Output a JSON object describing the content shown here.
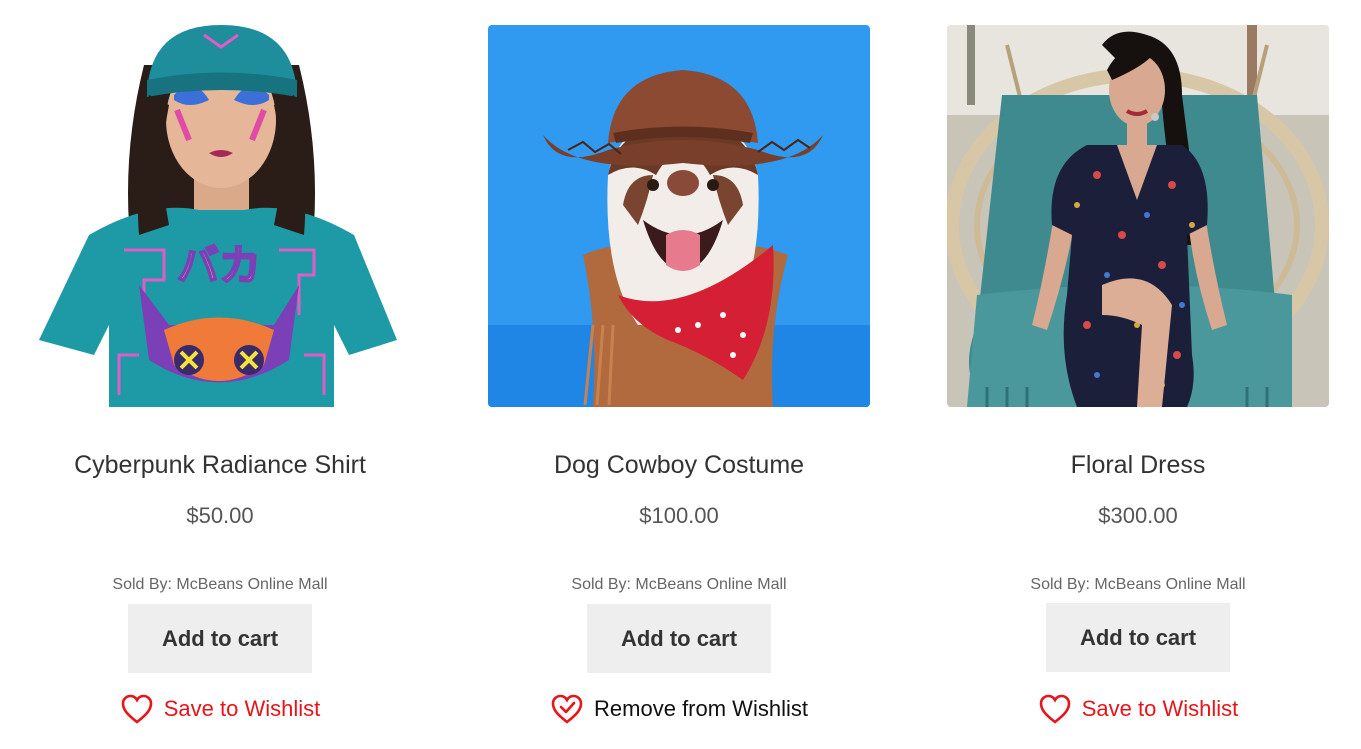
{
  "products": [
    {
      "title": "Cyberpunk Radiance Shirt",
      "price": "$50.00",
      "sold_by": "Sold By: McBeans Online Mall",
      "cart_label": "Add to cart",
      "wishlist_label": "Save to Wishlist",
      "wishlist_state": "save",
      "image_kind": "woman in teal graphic t-shirt and beanie",
      "shirt_text": "バカ"
    },
    {
      "title": "Dog Cowboy Costume",
      "price": "$100.00",
      "sold_by": "Sold By: McBeans Online Mall",
      "cart_label": "Add to cart",
      "wishlist_label": "Remove from Wishlist",
      "wishlist_state": "remove",
      "image_kind": "husky dog in cowboy hat and red bandana"
    },
    {
      "title": "Floral Dress",
      "price": "$300.00",
      "sold_by": "Sold By: McBeans Online Mall",
      "cart_label": "Add to cart",
      "wishlist_label": "Save to Wishlist",
      "wishlist_state": "save",
      "image_kind": "woman in floral dress on hanging rattan chair"
    }
  ],
  "colors": {
    "wishlist_red": "#e8141b",
    "button_bg": "#eeeeee",
    "dog_bg": "#2f9af0"
  },
  "icons": {
    "heart_outline": "heart-icon",
    "heart_check": "heart-check-icon"
  }
}
